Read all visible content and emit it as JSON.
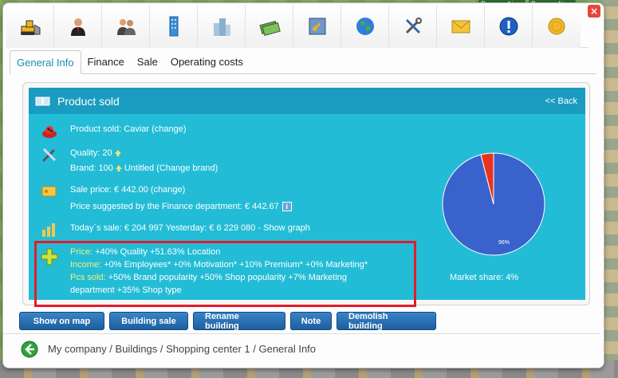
{
  "map": {
    "top_labels": [
      "Buenos Aires",
      "Buenos Aires"
    ]
  },
  "toolbar": {
    "icons": [
      "bulldozer-icon",
      "manager-icon",
      "employees-icon",
      "building-icon",
      "buildings-icon",
      "money-icon",
      "map-key-icon",
      "globe-icon",
      "tools-icon",
      "mail-icon",
      "alert-icon",
      "coin-icon"
    ]
  },
  "tabs": [
    {
      "label": "General Info",
      "active": true
    },
    {
      "label": "Finance"
    },
    {
      "label": "Sale"
    },
    {
      "label": "Operating costs"
    }
  ],
  "panel": {
    "title": "Product sold",
    "back": "<< Back",
    "product": "Product sold: Caviar (change)",
    "quality": "Quality: 20",
    "brand_prefix": "Brand:  100",
    "brand_suffix": "Untitled  (Change brand)",
    "sale_price": "Sale price: € 442.00 (change)",
    "suggested": "Price suggested by the Finance department: € 442.67",
    "sales": "Today`s sale: € 204 997 Yesterday: € 6 229 080 - Show graph",
    "bonus": {
      "price_label": "Price:",
      "price_text": " +40% Quality +51.63% Location",
      "income_label": "Income:",
      "income_text": " +0% Employees* +0% Motivation* +10% Premium* +0% Marketing*",
      "pcs_label": "Pcs sold:",
      "pcs_text": " +50% Brand popularity +50% Shop popularity +7% Marketing",
      "pcs_text2": "department +35% Shop type"
    },
    "pie": {
      "main_label": "96%",
      "main_value": 96,
      "other_value": 4,
      "main_color": "#3a62cc",
      "other_color": "#e8321f"
    },
    "market_share": "Market share: 4%"
  },
  "buttons": [
    "Show on map",
    "Building sale",
    "Rename building",
    "Note",
    "Demolish building"
  ],
  "breadcrumb": "My company / Buildings / Shopping center 1 / General Info",
  "colors": {
    "panel_bg": "#23bcd6",
    "panel_header": "#1a9cc0",
    "highlight": "#f0f27a",
    "red_box": "#e21b2b"
  }
}
